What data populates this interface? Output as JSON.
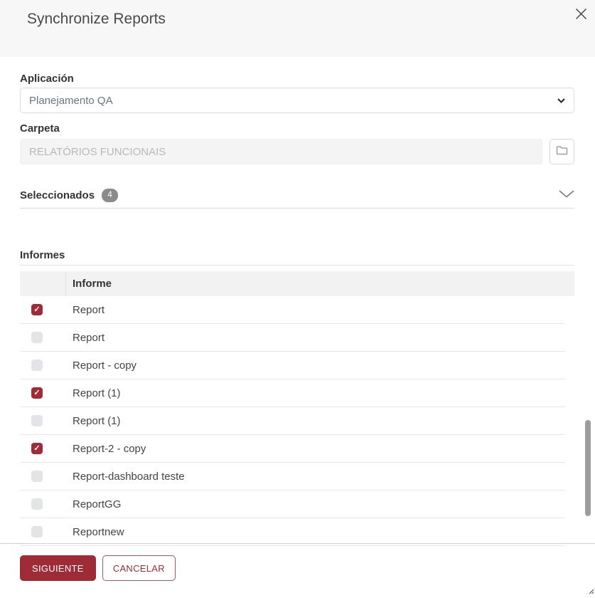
{
  "colors": {
    "accent": "#9e2b36",
    "accent_border": "#a9565e",
    "header_bg": "#f7f7f7",
    "badge_bg": "#8b8b8b",
    "scrollbar_thumb": "#9d9d9d"
  },
  "header": {
    "title": "Synchronize Reports"
  },
  "icons": {
    "checkmark": "✓"
  },
  "form": {
    "application": {
      "label": "Aplicación",
      "selected": "Planejamento QA"
    },
    "folder": {
      "label": "Carpeta",
      "value": "RELATÓRIOS FUNCIONAIS"
    }
  },
  "selected_section": {
    "label": "Seleccionados",
    "count": "4"
  },
  "reports": {
    "section_label": "Informes",
    "column_header": "Informe",
    "rows": [
      {
        "name": "Report",
        "checked": true
      },
      {
        "name": "Report",
        "checked": false
      },
      {
        "name": "Report - copy",
        "checked": false
      },
      {
        "name": "Report (1)",
        "checked": true
      },
      {
        "name": "Report (1)",
        "checked": false
      },
      {
        "name": "Report-2 - copy",
        "checked": true
      },
      {
        "name": "Report-dashboard teste",
        "checked": false
      },
      {
        "name": "ReportGG",
        "checked": false
      },
      {
        "name": "Reportnew",
        "checked": false
      }
    ]
  },
  "footer": {
    "next_label": "SIGUIENTE",
    "cancel_label": "CANCELAR"
  }
}
